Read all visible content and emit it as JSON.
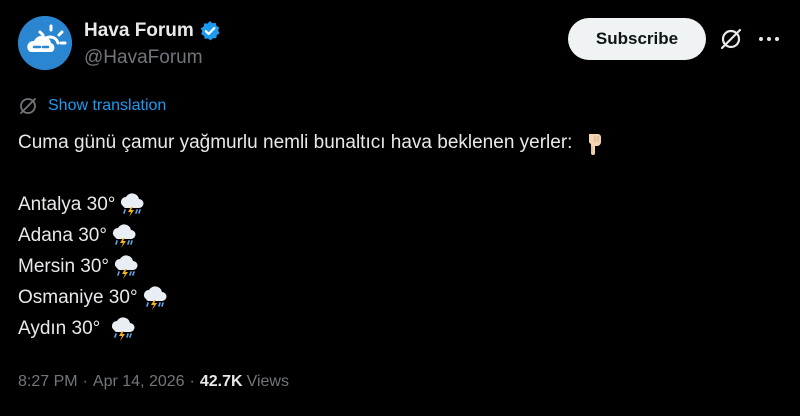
{
  "author": {
    "display_name": "Hava Forum",
    "handle": "@HavaForum",
    "avatar_icon": "cloud-sun-icon",
    "verified_icon": "verified-badge-icon",
    "verified_color": "#1d9bf0"
  },
  "actions": {
    "subscribe_label": "Subscribe",
    "grok_icon": "grok-icon",
    "more_icon": "more-horizontal-icon"
  },
  "translation": {
    "label": "Show translation",
    "icon": "globe-icon"
  },
  "tweet": {
    "intro": "Cuma günü çamur yağmurlu nemli bunaltıcı hava beklenen yerler:",
    "intro_emoji": "pointing-down-hand-icon",
    "cities": [
      {
        "text": "Antalya 30°",
        "emoji": "cloud-lightning-rain-icon"
      },
      {
        "text": "Adana 30°",
        "emoji": "cloud-lightning-rain-icon"
      },
      {
        "text": "Mersin 30°",
        "emoji": "cloud-lightning-rain-icon"
      },
      {
        "text": "Osmaniye 30°",
        "emoji": "cloud-lightning-rain-icon"
      },
      {
        "text": "Aydın 30°",
        "emoji": "cloud-lightning-rain-icon"
      }
    ]
  },
  "meta": {
    "time": "8:27 PM",
    "separator": "·",
    "date": "Apr 14, 2026",
    "views_count": "42.7K",
    "views_label": "Views"
  },
  "colors": {
    "background": "#000000",
    "text": "#e7e9ea",
    "secondary": "#71767b",
    "accent": "#1d9bf0",
    "subscribe_bg": "#eff3f4"
  }
}
